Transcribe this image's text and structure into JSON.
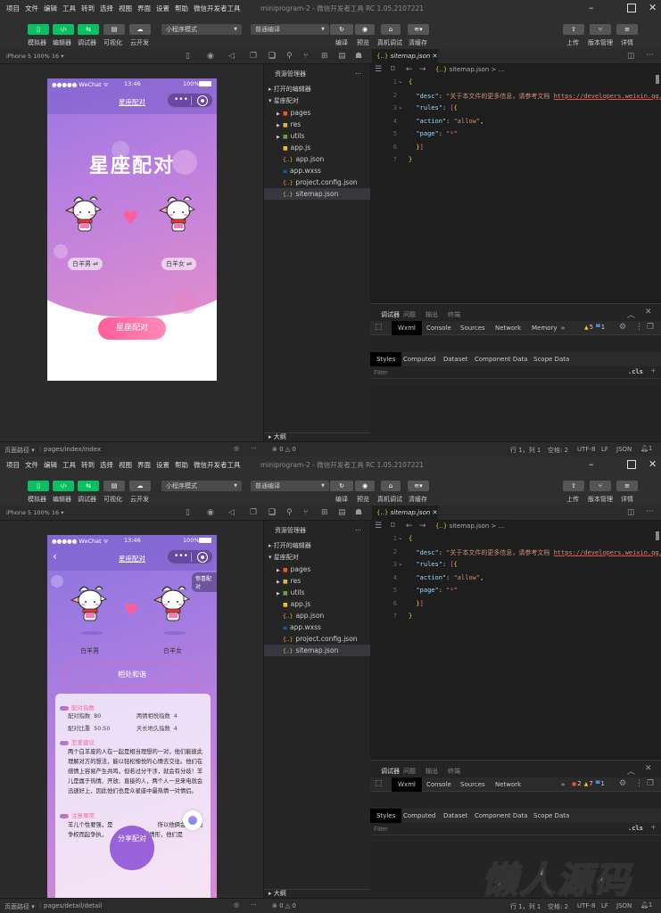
{
  "menu": [
    "项目",
    "文件",
    "编辑",
    "工具",
    "转到",
    "选择",
    "视图",
    "界面",
    "设置",
    "帮助",
    "微信开发者工具"
  ],
  "window_title": "miniprogram-2 - 微信开发者工具 RC 1.05.2107221",
  "toolbar": {
    "simulator": "模拟器",
    "editor": "编辑器",
    "debugger": "调试器",
    "visual": "可视化",
    "cloud": "云开发",
    "mode_select": "小程序模式",
    "compile_select": "普通编译",
    "compile": "编译",
    "preview": "预览",
    "remote_debug": "真机调试",
    "clear_cache": "清缓存",
    "upload": "上传",
    "version": "版本管理",
    "details": "详情"
  },
  "sim_header": "iPhone 5 100% 16 ▾",
  "explorer": {
    "title": "资源管理器",
    "more": "···",
    "open_editors": "打开的编辑器",
    "project": "星座配对",
    "files": [
      {
        "name": "pages",
        "icon": "folder-red-icon"
      },
      {
        "name": "res",
        "icon": "folder-yellow-icon"
      },
      {
        "name": "utils",
        "icon": "folder-green-icon"
      },
      {
        "name": "app.js",
        "icon": "js-file-icon"
      },
      {
        "name": "app.json",
        "icon": "json-file-icon"
      },
      {
        "name": "app.wxss",
        "icon": "css-file-icon"
      },
      {
        "name": "project.config.json",
        "icon": "json-file-icon"
      },
      {
        "name": "sitemap.json",
        "icon": "json-file-icon"
      }
    ],
    "outline": "大纲"
  },
  "editor": {
    "tab": "sitemap.json",
    "breadcrumb": "sitemap.json > ...",
    "lines": [
      [
        [
          "b",
          "{"
        ]
      ],
      [
        [
          "k",
          "  \"desc\""
        ],
        [
          "p",
          ": "
        ],
        [
          "s",
          "\"关于本文件的更多信息，请参考文档 "
        ],
        [
          "u",
          "https://developers.weixin.qq.com"
        ]
      ],
      [
        [
          "k",
          "  \"rules\""
        ],
        [
          "p",
          ": "
        ],
        [
          "b2",
          "["
        ],
        [
          "b",
          "{"
        ]
      ],
      [
        [
          "k",
          "  \"action\""
        ],
        [
          "p",
          ": "
        ],
        [
          "s",
          "\"allow\""
        ],
        [
          "p",
          ","
        ]
      ],
      [
        [
          "k",
          "  \"page\""
        ],
        [
          "p",
          ": "
        ],
        [
          "s",
          "\""
        ],
        [
          "r",
          "*"
        ],
        [
          "s",
          "\""
        ]
      ],
      [
        [
          "b",
          "  }"
        ],
        [
          "b2",
          "]"
        ]
      ],
      [
        [
          "b",
          "}"
        ]
      ]
    ]
  },
  "devtools": {
    "panel_tabs": [
      "调试器",
      "问题",
      "输出",
      "终端"
    ],
    "styles_tabs": [
      "Styles",
      "Computed",
      "Dataset",
      "Component Data",
      "Scope Data"
    ],
    "filter_placeholder": "Filter",
    "cls": ".cls",
    "plus": "+"
  },
  "status": {
    "page_path_label": "页面路径 ▾",
    "errors": "⊗ 0 △ 0",
    "cursor": "行 1，列 1",
    "spaces": "空格: 2",
    "encoding": "UTF-8",
    "eol": "LF",
    "lang": "JSON",
    "bell": "1"
  },
  "windows": [
    {
      "page_path": "pages/index/index",
      "tool_tabs": [
        "Wxml",
        "Console",
        "Sources",
        "Network",
        "Memory",
        "»"
      ],
      "badges": [
        {
          "icon": "warning-icon",
          "glyph": "▲",
          "color": "#f5c518",
          "count": "5"
        },
        {
          "icon": "info-icon",
          "glyph": "▀",
          "color": "#3a8ee6",
          "count": "1"
        }
      ]
    },
    {
      "page_path": "pages/detail/detail",
      "tool_tabs": [
        "Wxml",
        "Console",
        "Sources",
        "Network",
        "»"
      ],
      "badges": [
        {
          "icon": "error-icon",
          "glyph": "●",
          "color": "#f04848",
          "count": "2"
        },
        {
          "icon": "warning-icon",
          "glyph": "▲",
          "color": "#f5c518",
          "count": "7"
        },
        {
          "icon": "info-icon",
          "glyph": "▀",
          "color": "#3a8ee6",
          "count": "1"
        }
      ]
    }
  ],
  "phone": {
    "carrier": "●●●●● WeChat ᯤ",
    "time": "13:46",
    "battery": "100%",
    "nav_title": "星座配对"
  },
  "index_page": {
    "hero_title": "星座配对",
    "male": "白羊男 ⇌",
    "female": "白羊女 ⇌",
    "match_button": "星座配对"
  },
  "detail_page": {
    "surprise_tag": "惊喜配对",
    "male": "白羊男",
    "female": "白羊女",
    "result": "相处和谐",
    "sec_index": "配对指数",
    "idx1_label": "配对指数",
    "idx1_value": "80",
    "idx2_label": "两情相悦指数",
    "idx2_value": "4",
    "idx3_label": "配对比重",
    "idx3_value": "50:50",
    "idx4_label": "天长地久指数",
    "idx4_value": "4",
    "sec_advice": "恋爱建议",
    "advice": "两个白羊座的人在一起是相当理想的一对，他们能彼此理解对方的想法，能以轻松愉悦的心情去交往。他们在感情上容易产生共鸣，但若过分干涉，就会有分歧！羊儿是属于热情、开放、直接的人，两个人一旦来电就会迅速好上，因此他们也是众星座中最热情一对情侣。",
    "sec_notes": "注意事项",
    "notes": "羊儿个性要强，是　　　　　　　　所以他俩会常常因争权而起争执，　　　　　　火爆情形，他们是",
    "share_button": "分享配对"
  },
  "watermark": "懒人源码"
}
